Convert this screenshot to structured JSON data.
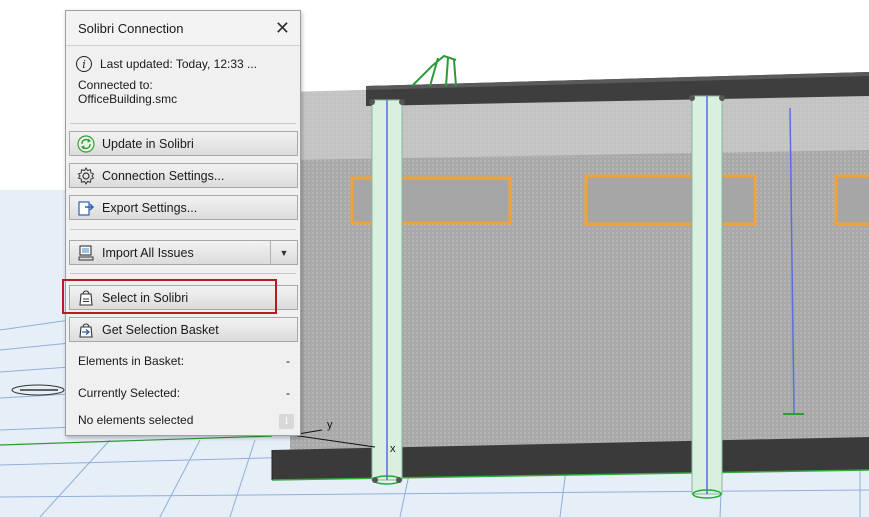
{
  "palette": {
    "title": "Solibri Connection",
    "close_symbol": "✕",
    "last_updated": "Last updated: Today, 12:33 ...",
    "connected_label": "Connected to:",
    "connected_file": "OfficeBuilding.smc",
    "buttons": {
      "update": "Update in Solibri",
      "connection_settings": "Connection Settings...",
      "export_settings": "Export Settings...",
      "import_issues": "Import All Issues",
      "select_in_solibri": "Select in Solibri",
      "get_basket": "Get Selection Basket"
    },
    "elements_in_basket_label": "Elements in Basket:",
    "elements_in_basket_value": "-",
    "currently_selected_label": "Currently Selected:",
    "currently_selected_value": "-",
    "status": "No elements selected"
  },
  "axes": {
    "x": "x",
    "y": "y"
  },
  "colors": {
    "highlight": "#b51d23",
    "opening": "#f2a23a",
    "column": "#d9efe0",
    "column_axis": "#5a6ee0",
    "grid": "#8fb0d8",
    "selection_green": "#22aa33"
  },
  "icons": [
    "info-icon",
    "sync-icon",
    "gear-icon",
    "export-icon",
    "import-icon",
    "chevron-down-icon",
    "select-icon",
    "basket-icon"
  ]
}
